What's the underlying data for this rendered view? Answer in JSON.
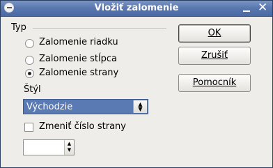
{
  "window": {
    "title": "Vložiť zalomenie"
  },
  "type_group": {
    "label": "Typ",
    "options": [
      {
        "label": "Zalomenie riadku",
        "checked": false
      },
      {
        "label": "Zalomenie stĺpca",
        "checked": false
      },
      {
        "label": "Zalomenie strany",
        "checked": true
      }
    ]
  },
  "style": {
    "label": "Štýl",
    "selected": "Východzie"
  },
  "change_page_number": {
    "label": "Zmeniť číslo strany",
    "checked": false
  },
  "page_number_input": {
    "value": ""
  },
  "buttons": {
    "ok": "OK",
    "cancel": "Zrušiť",
    "help": "Pomocník"
  },
  "colors": {
    "titlebar": "#5b79b0",
    "dialog_bg": "#eeede9",
    "selection": "#5a7ab3"
  }
}
